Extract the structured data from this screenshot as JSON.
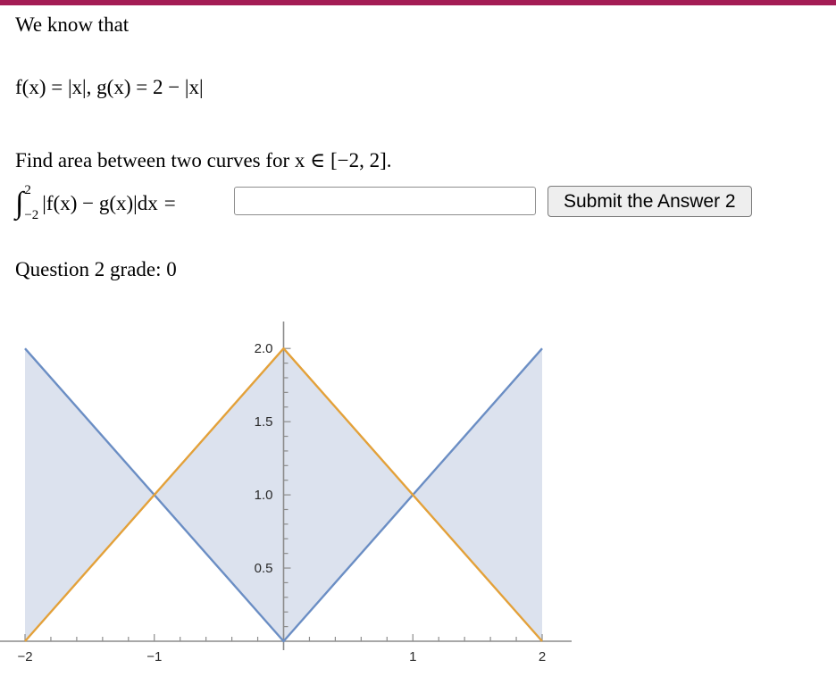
{
  "theme": {
    "accent_bar_color": "#a41c55",
    "curve_f_color": "#6b8ec4",
    "curve_g_color": "#e3a13a",
    "shade_color": "#dce2ee",
    "axis_color": "#8c8c8c",
    "button_bg": "#eeeeee"
  },
  "question": {
    "intro": "We know that",
    "functions": "f(x) = |x|, g(x) = 2 − |x|",
    "instruction": "Find area between two curves for x ∈ [−2, 2].",
    "grade_label": "Question 2 grade: 0"
  },
  "integral": {
    "sign": "∫",
    "upper_limit": "2",
    "lower_limit": "−2",
    "integrand": "|f(x) − g(x)|dx",
    "equals": "="
  },
  "answer_field": {
    "value": "",
    "placeholder": ""
  },
  "submit": {
    "label": "Submit the Answer 2"
  },
  "chart_data": {
    "type": "line",
    "title": "",
    "xlabel": "",
    "ylabel": "",
    "xlim": [
      -2,
      2
    ],
    "ylim": [
      0,
      2.05
    ],
    "grid": false,
    "legend": null,
    "x_ticks": [
      -2,
      -1,
      1,
      2
    ],
    "x_tick_labels": [
      "−2",
      "−1",
      "1",
      "2"
    ],
    "x_minor_tick_step": 0.2,
    "y_ticks": [
      0.5,
      1.0,
      1.5,
      2.0
    ],
    "y_tick_labels": [
      "0.5",
      "1.0",
      "1.5",
      "2.0"
    ],
    "y_minor_tick_step": 0.1,
    "series": [
      {
        "name": "f(x) = |x|",
        "color": "#6b8ec4",
        "x": [
          -2,
          0,
          2
        ],
        "values": [
          2,
          0,
          2
        ]
      },
      {
        "name": "g(x) = 2 − |x|",
        "color": "#e3a13a",
        "x": [
          -2,
          0,
          2
        ],
        "values": [
          0,
          2,
          0
        ]
      }
    ],
    "shaded_region": {
      "between": [
        "f(x) = |x|",
        "g(x) = 2 − |x|"
      ],
      "color": "#dce2ee",
      "x_range": [
        -2,
        2
      ]
    },
    "intersections": [
      {
        "x": -1,
        "y": 1
      },
      {
        "x": 1,
        "y": 1
      }
    ]
  }
}
